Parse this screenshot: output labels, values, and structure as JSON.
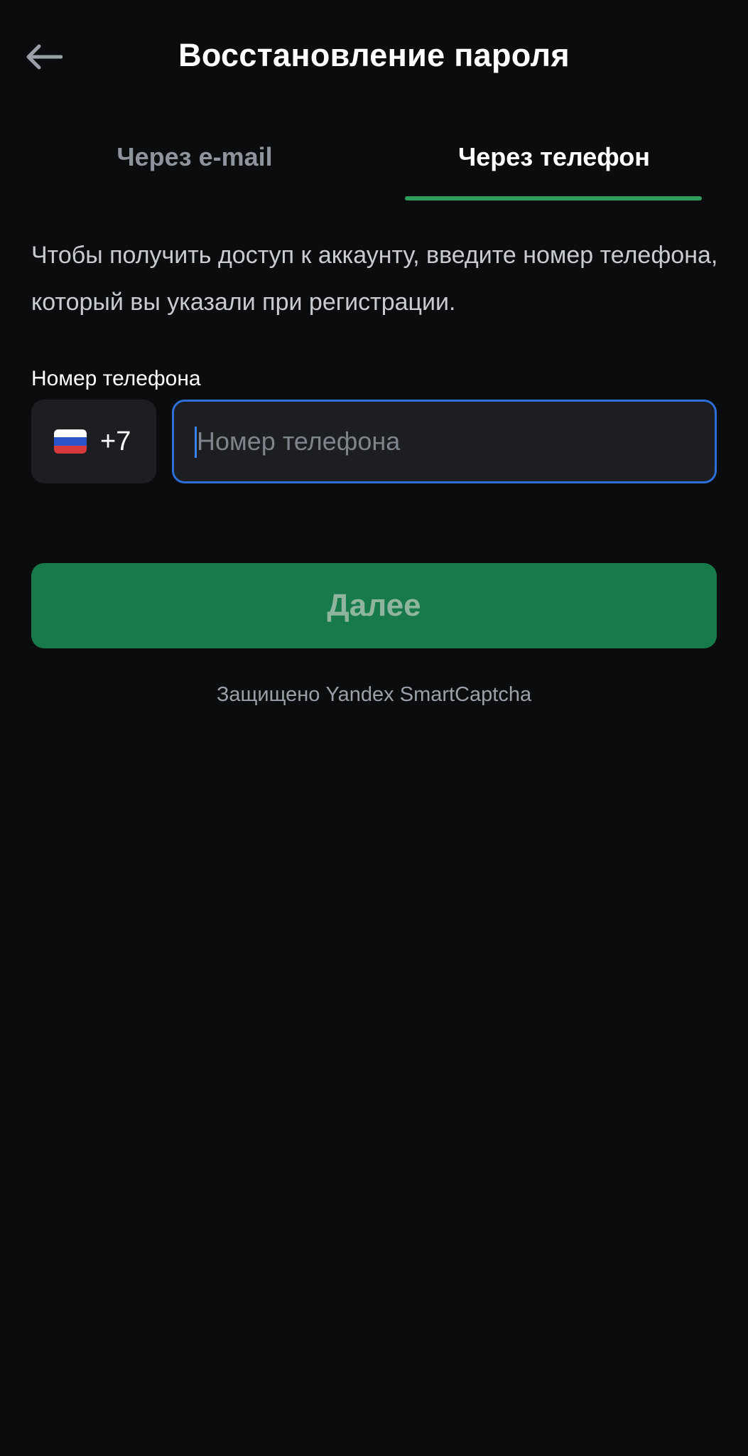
{
  "header": {
    "title": "Восстановление пароля",
    "back_icon": "arrow-left-icon"
  },
  "tabs": [
    {
      "label": "Через e-mail",
      "active": false
    },
    {
      "label": "Через телефон",
      "active": true
    }
  ],
  "description": "Чтобы получить доступ к аккаунту, введите номер телефона, который вы указали при регистрации.",
  "phone_field": {
    "label": "Номер телефона",
    "country_code": "+7",
    "country_flag": "russia-flag-icon",
    "placeholder": "Номер телефона",
    "value": ""
  },
  "next_button": {
    "label": "Далее"
  },
  "captcha_note": "Защищено Yandex SmartCaptcha",
  "colors": {
    "background": "#0b0c0e",
    "accent_green": "#2f9e5b",
    "button_green": "#187a4b",
    "input_focus": "#2d6fd8"
  }
}
